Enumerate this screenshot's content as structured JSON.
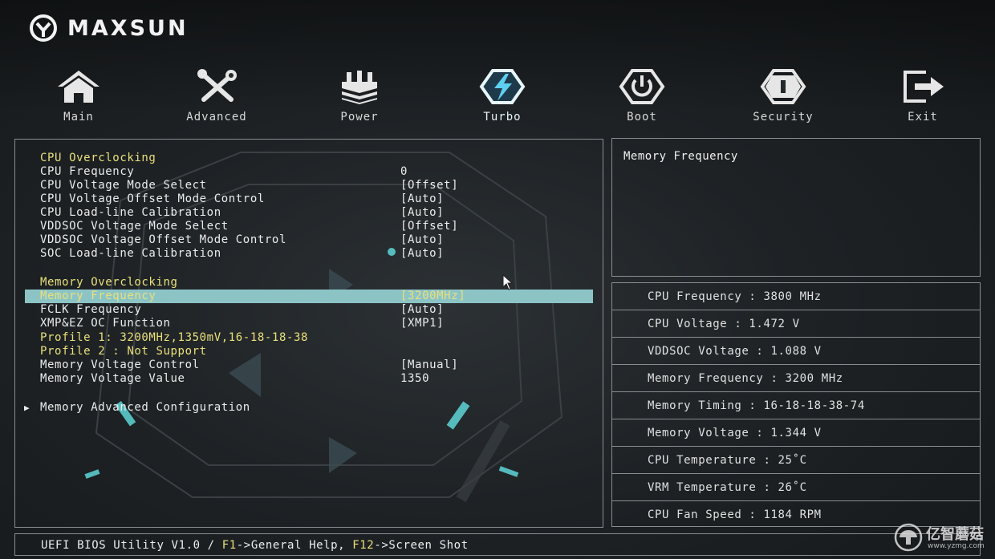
{
  "brand": {
    "name": "MAXSUN"
  },
  "nav": {
    "items": [
      {
        "label": "Main",
        "icon": "home-icon"
      },
      {
        "label": "Advanced",
        "icon": "tools-icon"
      },
      {
        "label": "Power",
        "icon": "power-chip-icon"
      },
      {
        "label": "Turbo",
        "icon": "lightning-icon",
        "active": true
      },
      {
        "label": "Boot",
        "icon": "power-button-icon"
      },
      {
        "label": "Security",
        "icon": "shield-icon"
      },
      {
        "label": "Exit",
        "icon": "exit-icon"
      }
    ]
  },
  "menu": {
    "cpu_section": "CPU Overclocking",
    "cpu_items": [
      {
        "label": "CPU Frequency",
        "value": "0"
      },
      {
        "label": "CPU Voltage Mode Select",
        "value": "[Offset]"
      },
      {
        "label": "CPU Voltage Offset Mode Control",
        "value": "[Auto]"
      },
      {
        "label": "CPU Load-line Calibration",
        "value": "[Auto]"
      },
      {
        "label": "VDDSOC Voltage Mode Select",
        "value": "[Offset]"
      },
      {
        "label": "VDDSOC Voltage Offset Mode Control",
        "value": "[Auto]"
      },
      {
        "label": "SOC Load-line Calibration",
        "value": "[Auto]"
      }
    ],
    "mem_section": "Memory Overclocking",
    "mem_selected": {
      "label": "Memory Frequency",
      "value": "[3200MHz]"
    },
    "mem_items": [
      {
        "label": "FCLK Frequency",
        "value": "[Auto]"
      },
      {
        "label": "XMP&EZ OC Function",
        "value": "[XMP1]"
      }
    ],
    "profile1": "Profile 1: 3200MHz,1350mV,16-18-18-38",
    "profile2": "Profile 2 : Not Support",
    "mem_voltage_items": [
      {
        "label": "Memory Voltage Control",
        "value": "[Manual]"
      },
      {
        "label": "Memory Voltage Value",
        "value": "1350"
      }
    ],
    "submenu": "Memory Advanced Configuration"
  },
  "help": {
    "title": "Memory Frequency"
  },
  "status": [
    "CPU Frequency : 3800 MHz",
    "CPU Voltage : 1.472 V",
    "VDDSOC Voltage : 1.088 V",
    "Memory Frequency : 3200 MHz",
    "Memory Timing : 16-18-18-38-74",
    "Memory Voltage : 1.344 V",
    "CPU Temperature : 25˚C",
    "VRM Temperature : 26˚C",
    "CPU Fan Speed : 1184 RPM"
  ],
  "footer": {
    "prefix": "UEFI BIOS Utility V1.0 / ",
    "key1": "F1",
    "text1": "->General Help, ",
    "key2": "F12",
    "text2": "->Screen Shot"
  },
  "watermark": {
    "text": "亿智蘑菇",
    "url": "www.yzmg.com"
  },
  "colors": {
    "section": "#e9e07a",
    "highlight": "#8cc4c6",
    "accent": "#5fd6d8",
    "border": "#8a8d90"
  }
}
